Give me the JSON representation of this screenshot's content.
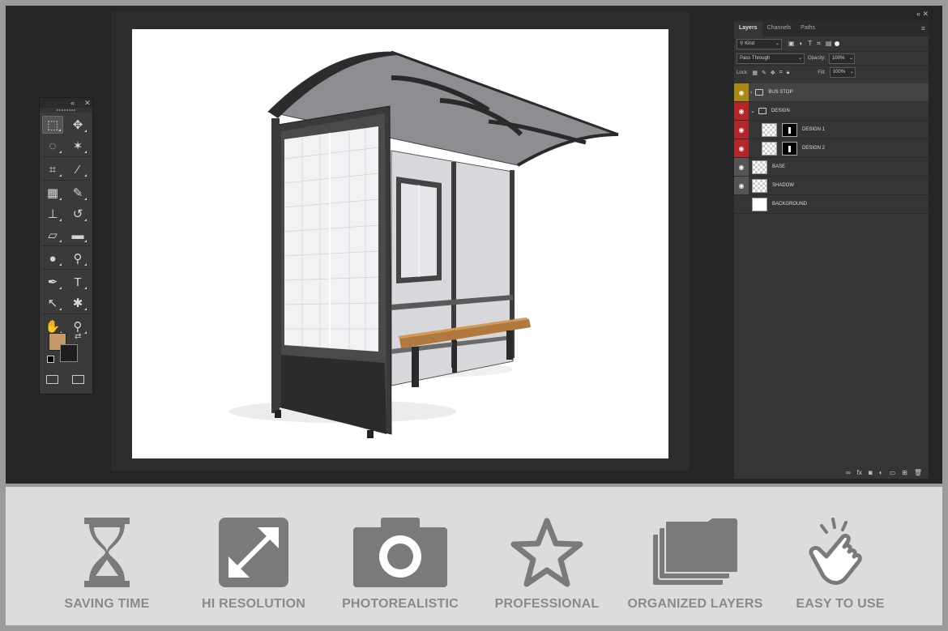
{
  "app": {
    "tools_panel": {
      "collapse_icon": "double-chevron-icon",
      "close_icon": "close-icon",
      "foreground_color": "#c49a66",
      "background_color": "#1e1e1e",
      "tools": [
        {
          "name": "marquee-tool",
          "glyph": "⬚"
        },
        {
          "name": "move-tool",
          "glyph": "✥"
        },
        {
          "name": "lasso-tool",
          "glyph": "◌"
        },
        {
          "name": "magic-wand-tool",
          "glyph": "✶"
        },
        {
          "name": "crop-tool",
          "glyph": "⌗"
        },
        {
          "name": "eyedropper-tool",
          "glyph": "⁄"
        },
        {
          "name": "healing-brush-tool",
          "glyph": "▦"
        },
        {
          "name": "brush-tool",
          "glyph": "✎"
        },
        {
          "name": "clone-stamp-tool",
          "glyph": "⊥"
        },
        {
          "name": "history-brush-tool",
          "glyph": "↺"
        },
        {
          "name": "eraser-tool",
          "glyph": "▱"
        },
        {
          "name": "gradient-tool",
          "glyph": "▬"
        },
        {
          "name": "blur-tool",
          "glyph": "●"
        },
        {
          "name": "dodge-tool",
          "glyph": "⚲"
        },
        {
          "name": "pen-tool",
          "glyph": "✒"
        },
        {
          "name": "type-tool",
          "glyph": "T"
        },
        {
          "name": "path-selection-tool",
          "glyph": "↖"
        },
        {
          "name": "custom-shape-tool",
          "glyph": "✱"
        },
        {
          "name": "hand-tool",
          "glyph": "✋"
        },
        {
          "name": "zoom-tool",
          "glyph": "⚲"
        }
      ]
    },
    "layers_panel": {
      "tabs": [
        {
          "label": "Layers",
          "active": true
        },
        {
          "label": "Channels",
          "active": false
        },
        {
          "label": "Paths",
          "active": false
        }
      ],
      "filter_kind": "Kind",
      "blend_mode": "Pass Through",
      "opacity_label": "Opacity:",
      "opacity_value": "100%",
      "lock_label": "Lock:",
      "fill_label": "Fill:",
      "fill_value": "100%",
      "layers": [
        {
          "name": "BUS STOP",
          "type": "group",
          "color": "#a88a12",
          "expanded": false
        },
        {
          "name": "DESIGN",
          "type": "group",
          "color": "#b3262a",
          "expanded": true
        },
        {
          "name": "DESIGN 1",
          "type": "smart",
          "color": "#b3262a"
        },
        {
          "name": "DESIGN 2",
          "type": "smart",
          "color": "#b3262a"
        },
        {
          "name": "BASE",
          "type": "layer",
          "color": "#555555"
        },
        {
          "name": "SHADOW",
          "type": "layer",
          "color": "#555555"
        },
        {
          "name": "BACKGROUND",
          "type": "background",
          "color": "#353535"
        }
      ]
    }
  },
  "features": [
    {
      "label": "SAVING TIME",
      "icon": "hourglass-icon"
    },
    {
      "label": "HI RESOLUTION",
      "icon": "expand-arrows-icon"
    },
    {
      "label": "PHOTOREALISTIC",
      "icon": "camera-icon"
    },
    {
      "label": "PROFESSIONAL",
      "icon": "star-icon"
    },
    {
      "label": "ORGANIZED LAYERS",
      "icon": "folders-icon"
    },
    {
      "label": "EASY TO USE",
      "icon": "tap-hand-icon"
    }
  ]
}
